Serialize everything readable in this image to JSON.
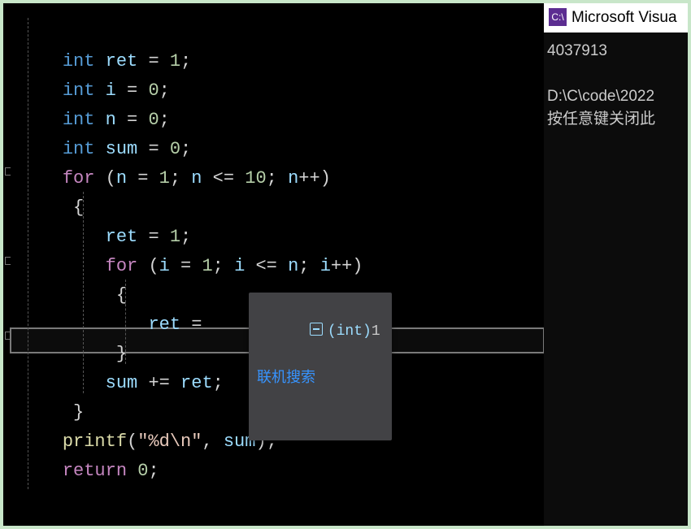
{
  "code": {
    "l1": {
      "kw": "int",
      "var": "ret",
      "op": "=",
      "val": "1",
      "semi": ";"
    },
    "l2": {
      "kw": "int",
      "var": "i",
      "op": "=",
      "val": "0",
      "semi": ";"
    },
    "l3": {
      "kw": "int",
      "var": "n",
      "op": "=",
      "val": "0",
      "semi": ";"
    },
    "l4": {
      "kw": "int",
      "var": "sum",
      "op": "=",
      "val": "0",
      "semi": ";"
    },
    "l5": {
      "kw": "for",
      "open": "(",
      "v1": "n",
      "eq1": "=",
      "n1": "1",
      "s1": ";",
      "v2": "n",
      "cmp": "<=",
      "n2": "10",
      "s2": ";",
      "v3": "n",
      "inc": "++",
      "close": ")"
    },
    "l6": {
      "brace": "{"
    },
    "l7": {
      "var": "ret",
      "op": "=",
      "val": "1",
      "semi": ";"
    },
    "l8": {
      "kw": "for",
      "open": "(",
      "v1": "i",
      "eq1": "=",
      "n1": "1",
      "s1": ";",
      "v2": "i",
      "cmp": "<=",
      "v3": "n",
      "s2": ";",
      "v4": "i",
      "inc": "++",
      "close": ")"
    },
    "l9": {
      "brace": "{"
    },
    "l10": {
      "var": "ret",
      "op": "=",
      "semi": ";"
    },
    "l11": {
      "brace": "}"
    },
    "l12": {
      "var": "sum",
      "op": "+=",
      "var2": "ret",
      "semi": ";"
    },
    "l13": {
      "brace": "}"
    },
    "l14": {
      "func": "printf",
      "open": "(",
      "str": "\"%d\\n\"",
      "comma": ",",
      "arg": "sum",
      "close": ")",
      "semi": ";"
    },
    "l15": {
      "kw": "return",
      "val": "0",
      "semi": ";"
    }
  },
  "tooltip": {
    "type": "(int)",
    "value": "1",
    "link": "联机搜索"
  },
  "console": {
    "title": "Microsoft Visua",
    "icon": "C:\\",
    "line1": "4037913",
    "line2": "D:\\C\\code\\2022",
    "line3": "按任意键关闭此"
  }
}
